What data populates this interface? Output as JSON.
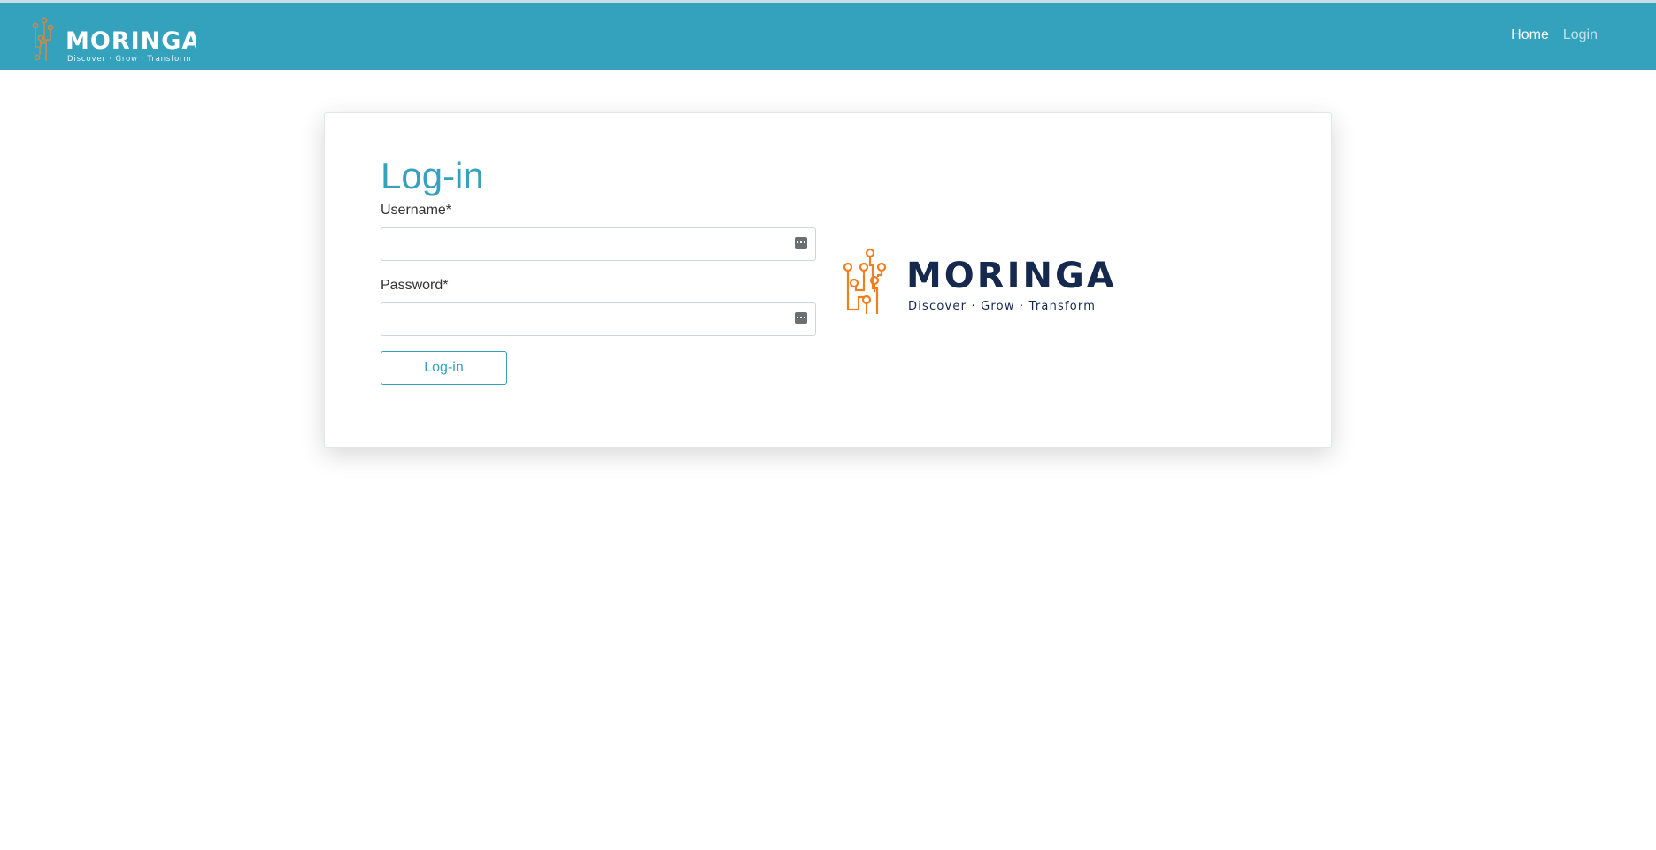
{
  "header": {
    "brand": {
      "name": "MORINGA",
      "tagline": "Discover · Grow · Transform"
    },
    "nav": {
      "home_label": "Home",
      "login_label": "Login"
    }
  },
  "login_form": {
    "title": "Log-in",
    "username_label": "Username*",
    "username_value": "",
    "password_label": "Password*",
    "password_value": "",
    "submit_label": "Log-in"
  },
  "card_logo": {
    "name": "MORINGA",
    "tagline": "Discover · Grow · Transform"
  },
  "colors": {
    "navbar": "#34a2bd",
    "accent": "#34a2bd",
    "logo_orange": "#f07f22",
    "logo_navy": "#14294d"
  }
}
